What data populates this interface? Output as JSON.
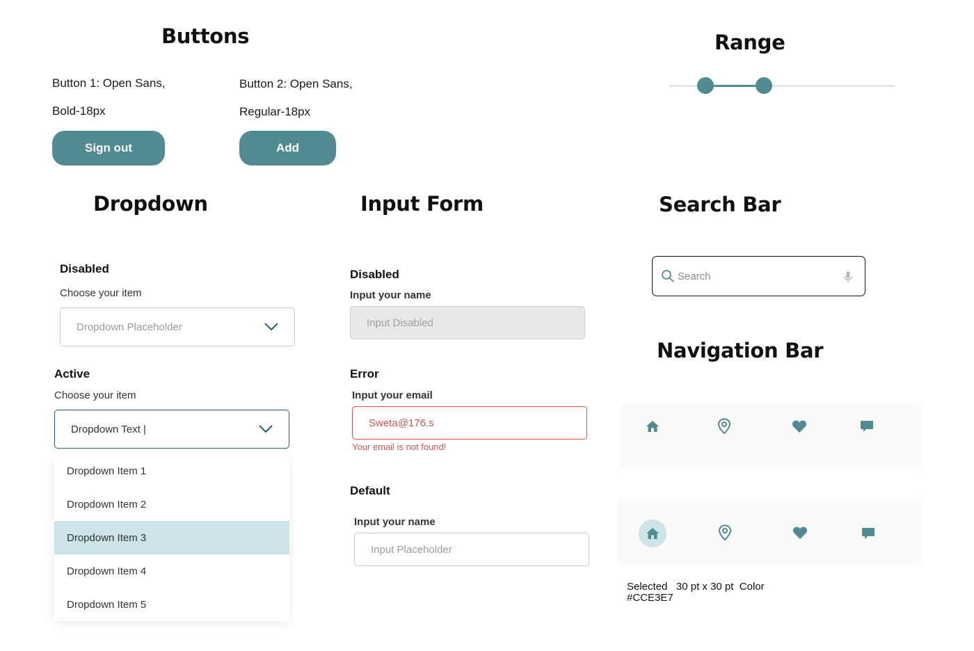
{
  "buttons": {
    "title": "Buttons",
    "button1_desc_line1": "Button 1: Open Sans,",
    "button1_desc_line2": "Bold-18px",
    "button2_desc_line1": "Button 2: Open Sans,",
    "button2_desc_line2": "Regular-18px",
    "sign_out_label": "Sign out",
    "add_label": "Add"
  },
  "range": {
    "title": "Range",
    "low_value": 0.16,
    "high_value": 0.42
  },
  "dropdown": {
    "title": "Dropdown",
    "disabled_heading": "Disabled",
    "disabled_label": "Choose your item",
    "disabled_placeholder": "Dropdown Placeholder",
    "active_heading": "Active",
    "active_label": "Choose your item",
    "active_value": "Dropdown Text |",
    "items": [
      "Dropdown Item 1",
      "Dropdown Item 2",
      "Dropdown Item 3",
      "Dropdown Item 4",
      "Dropdown Item 5"
    ],
    "selected_item": "Dropdown Item 3"
  },
  "input_form": {
    "title": "Input Form",
    "disabled_heading": "Disabled",
    "disabled_label": "Input your name",
    "disabled_value": "Input Disabled",
    "error_heading": "Error",
    "error_label": "Input your email",
    "error_value": "Sweta@176.s",
    "error_message": "Your email is not found!",
    "default_heading": "Default",
    "default_label": "Input your name",
    "default_placeholder": "Input Placeholder"
  },
  "search_bar": {
    "title": "Search Bar",
    "placeholder": "Search",
    "search_icon": "search-icon",
    "mic_icon": "microphone-icon"
  },
  "navigation_bar": {
    "title": "Navigation Bar",
    "icons": [
      "home-icon",
      "location-pin-icon",
      "heart-icon",
      "chat-icon"
    ],
    "note_line1": "Selected   30 pt x 30 pt  Color",
    "note_line2": "#CCE3E7"
  },
  "colors": {
    "accent": "#518b92",
    "selected_bg": "#cce3e7",
    "error": "#d9534f",
    "active_border": "#1f5f73"
  }
}
